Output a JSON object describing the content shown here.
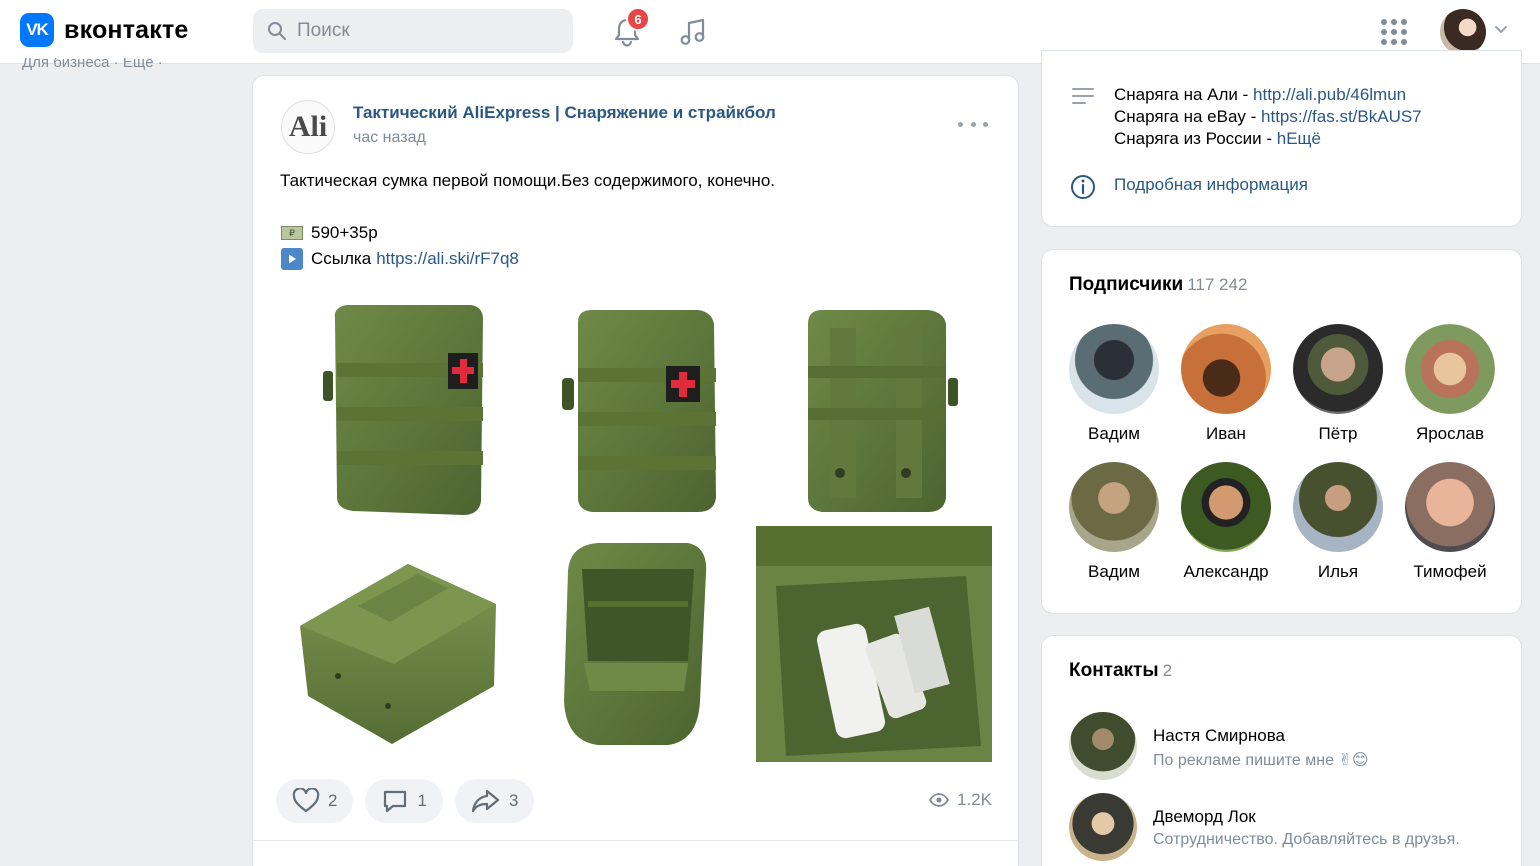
{
  "header": {
    "logo_mark": "VK",
    "logo_text": "вконтакте",
    "search_placeholder": "Поиск",
    "notifications_count": "6"
  },
  "left_strip": "Для бизнеса · Ещё ·",
  "post": {
    "author": "Тактический AliExpress | Снаряжение и страйкбол",
    "time": "час назад",
    "avatar_text": "Ali",
    "text": "Тактическая сумка первой помощи.Без содержимого, конечно.",
    "price": "590+35р",
    "link_label": "Ссылка",
    "link_url": "https://ali.ski/rF7q8",
    "likes": "2",
    "comments": "1",
    "shares": "3",
    "views": "1.2K"
  },
  "info": {
    "line1_label": "Снаряга на Али - ",
    "line1_link": "http://ali.pub/46lmun",
    "line2_label": "Снаряга на eBay - ",
    "line2_link": "https://fas.st/BkAUS7",
    "line3_label": "Снаряга из России - ",
    "line3_link": "hЕщё",
    "more_info": "Подробная информация"
  },
  "subscribers": {
    "title": "Подписчики",
    "count": "117 242",
    "people": [
      {
        "name": "Вадим"
      },
      {
        "name": "Иван"
      },
      {
        "name": "Пётр"
      },
      {
        "name": "Ярослав"
      },
      {
        "name": "Вадим"
      },
      {
        "name": "Александр"
      },
      {
        "name": "Илья"
      },
      {
        "name": "Тимофей"
      }
    ]
  },
  "contacts": {
    "title": "Контакты",
    "count": "2",
    "people": [
      {
        "name": "Настя Смирнова",
        "subtitle": "По рекламе пишите мне ✌😊"
      },
      {
        "name": "Двеморд Лок",
        "subtitle": "Сотрудничество. Добавляйтесь в друзья."
      }
    ]
  },
  "colors": {
    "accent": "#0077ff",
    "link": "#2a5885",
    "badge": "#e64646",
    "pouch": "#5f7a3a"
  }
}
